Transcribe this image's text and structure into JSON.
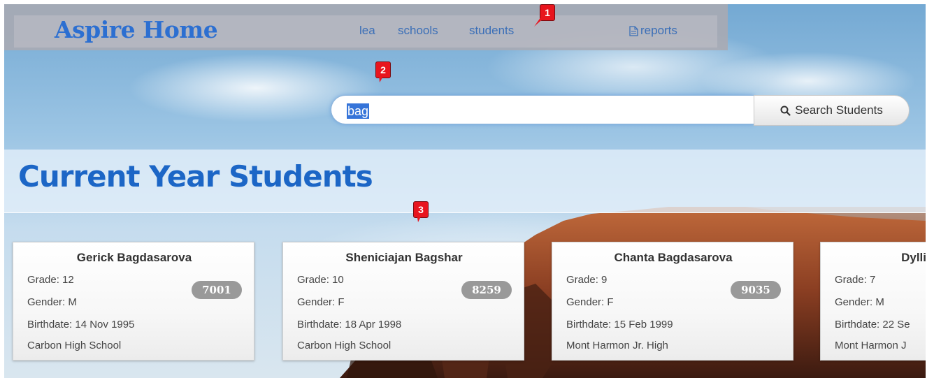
{
  "navbar": {
    "brand": "Aspire Home",
    "links": [
      "lea",
      "schools",
      "students"
    ],
    "reports_label": "reports"
  },
  "markers": [
    "1",
    "2",
    "3"
  ],
  "search": {
    "value": "bag",
    "button_label": "Search Students"
  },
  "page": {
    "title": "Current Year Students"
  },
  "students": [
    {
      "name": "Gerick Bagdasarova",
      "grade": "Grade: 12",
      "gender": "Gender: M",
      "birthdate": "Birthdate: 14 Nov 1995",
      "school": "Carbon High School",
      "id": "7001"
    },
    {
      "name": "Sheniciajan Bagshar",
      "grade": "Grade: 10",
      "gender": "Gender: F",
      "birthdate": "Birthdate: 18 Apr 1998",
      "school": "Carbon High School",
      "id": "8259"
    },
    {
      "name": "Chanta Bagdasarova",
      "grade": "Grade: 9",
      "gender": "Gender: F",
      "birthdate": "Birthdate: 15 Feb 1999",
      "school": "Mont Harmon Jr. High",
      "id": "9035"
    },
    {
      "name": "Dylli",
      "grade": "Grade: 7",
      "gender": "Gender: M",
      "birthdate": "Birthdate: 22 Se",
      "school": "Mont Harmon J",
      "id": ""
    }
  ]
}
